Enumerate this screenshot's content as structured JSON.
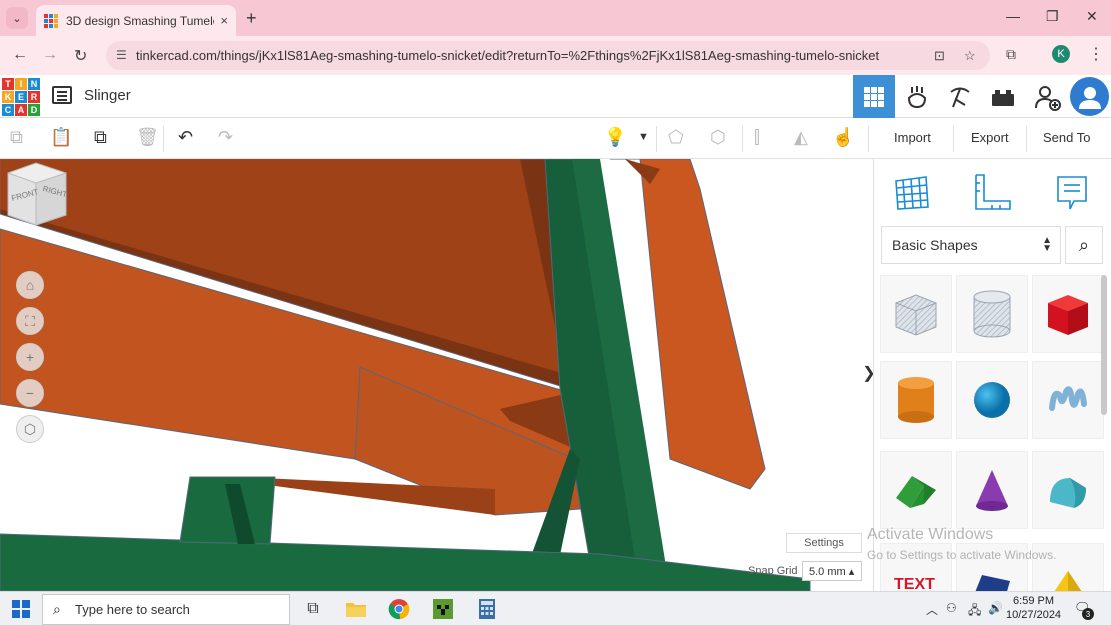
{
  "browser": {
    "tab_title": "3D design Smashing Tumelo-Sn",
    "tab_close": "×",
    "new_tab": "+",
    "url": "tinkercad.com/things/jKx1lS81Aeg-smashing-tumelo-snicket/edit?returnTo=%2Fthings%2FjKx1lS81Aeg-smashing-tumelo-snicket",
    "profile_initial": "K"
  },
  "app": {
    "logo_letters": [
      "TIN",
      "KER",
      "CAD"
    ],
    "design_title": "Slinger",
    "toolbar": {
      "import_label": "Import",
      "export_label": "Export",
      "send_to_label": "Send To"
    }
  },
  "workplane": {
    "viewcube_faces": [
      "FRONT",
      "RIGHT"
    ],
    "settings_label": "Settings",
    "snap_grid_label": "Snap Grid",
    "snap_grid_value": "5.0 mm ▴"
  },
  "panel": {
    "library_select": "Basic Shapes",
    "shapes": [
      {
        "name": "box-hole",
        "color": "#b9c4cf"
      },
      {
        "name": "cylinder-hole",
        "color": "#b9c4cf"
      },
      {
        "name": "box",
        "color": "#e0192a"
      },
      {
        "name": "cylinder",
        "color": "#e58a1c"
      },
      {
        "name": "sphere",
        "color": "#1a93d3"
      },
      {
        "name": "scribble",
        "color": "#7fb2d6"
      },
      {
        "name": "roof",
        "color": "#2aa136"
      },
      {
        "name": "cone",
        "color": "#8a3bb0"
      },
      {
        "name": "round-roof",
        "color": "#4ab8c6"
      },
      {
        "name": "text",
        "color": "#d3182a"
      },
      {
        "name": "wedge",
        "color": "#1f3e8a"
      },
      {
        "name": "pyramid",
        "color": "#f5c516"
      }
    ]
  },
  "overlay": {
    "activate_title": "Activate Windows",
    "activate_sub": "Go to Settings to activate Windows."
  },
  "taskbar": {
    "search_placeholder": "Type here to search",
    "time": "6:59 PM",
    "date": "10/27/2024",
    "notification_count": "3"
  },
  "colors": {
    "accent_blue": "#3d8fd6",
    "model_orange": "#c2541f",
    "model_dark": "#7a3413",
    "model_green": "#175f3a"
  }
}
